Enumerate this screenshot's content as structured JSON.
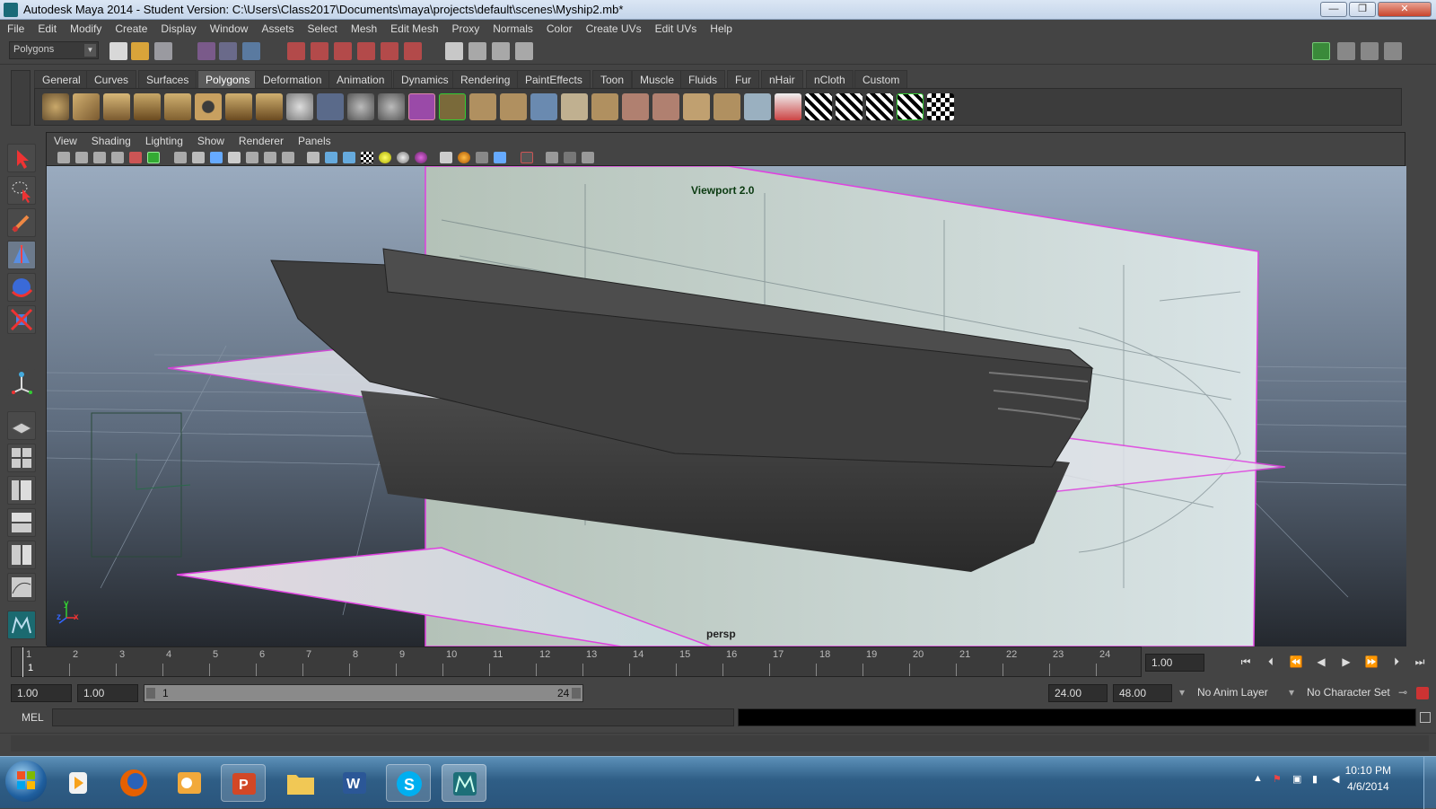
{
  "window": {
    "title": "Autodesk Maya 2014 - Student Version: C:\\Users\\Class2017\\Documents\\maya\\projects\\default\\scenes\\Myship2.mb*",
    "minimize": "—",
    "restore": "❐",
    "close": "✕"
  },
  "menubar": {
    "items": [
      "File",
      "Edit",
      "Modify",
      "Create",
      "Display",
      "Window",
      "Assets",
      "Select",
      "Mesh",
      "Edit Mesh",
      "Proxy",
      "Normals",
      "Color",
      "Create UVs",
      "Edit UVs",
      "Help"
    ]
  },
  "statusline": {
    "mode": "Polygons"
  },
  "shelf": {
    "tabs": [
      "General",
      "Curves",
      "Surfaces",
      "Polygons",
      "Deformation",
      "Animation",
      "Dynamics",
      "Rendering",
      "PaintEffects",
      "Toon",
      "Muscle",
      "Fluids",
      "Fur",
      "nHair",
      "nCloth",
      "Custom"
    ],
    "active_tab": "Polygons"
  },
  "viewport": {
    "menus": [
      "View",
      "Shading",
      "Lighting",
      "Show",
      "Renderer",
      "Panels"
    ],
    "renderer_label": "Viewport 2.0",
    "camera_label": "persp",
    "axis": {
      "y": "y",
      "x": "x",
      "z": "z"
    }
  },
  "timeline": {
    "ticks": [
      "1",
      "2",
      "3",
      "4",
      "5",
      "6",
      "7",
      "8",
      "9",
      "10",
      "11",
      "12",
      "13",
      "14",
      "15",
      "16",
      "17",
      "18",
      "19",
      "20",
      "21",
      "22",
      "23",
      "24"
    ],
    "current_frame_marker": "1",
    "current_time": "1.00"
  },
  "range": {
    "start_time": "1.00",
    "playback_start": "1.00",
    "range_start_label": "1",
    "range_end_label": "24",
    "playback_end": "24.00",
    "end_time": "48.00",
    "anim_layer": "No Anim Layer",
    "character_set": "No Character Set"
  },
  "commandline": {
    "language": "MEL"
  },
  "taskbar": {
    "time": "10:10 PM",
    "date": "4/6/2014"
  }
}
